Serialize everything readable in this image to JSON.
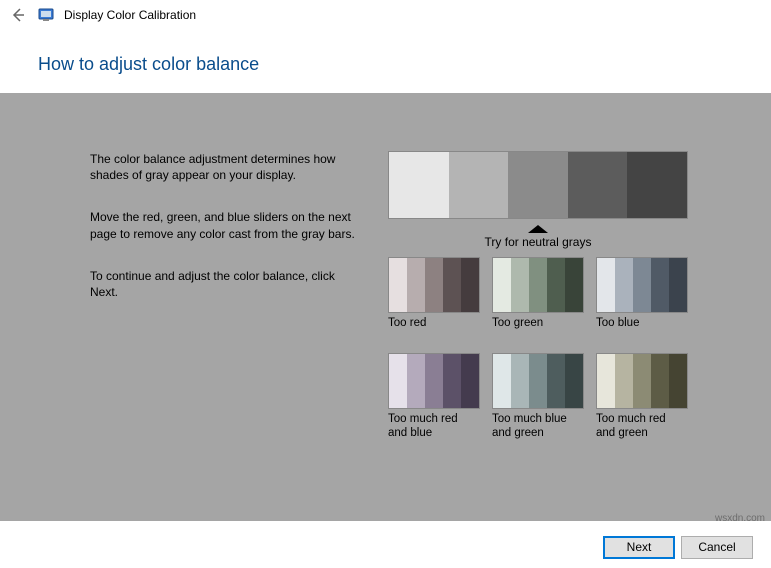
{
  "window": {
    "title": "Display Color Calibration"
  },
  "heading": "How to adjust color balance",
  "paragraphs": {
    "p1": "The color balance adjustment determines how shades of gray appear on your display.",
    "p2": "Move the red, green, and blue sliders on the next page to remove any color cast from the gray bars.",
    "p3": "To continue and adjust the color balance, click Next."
  },
  "neutral_label": "Try for neutral grays",
  "neutral_colors": [
    "#e7e7e7",
    "#b4b4b4",
    "#8b8b8b",
    "#5c5c5c",
    "#444444"
  ],
  "samples": [
    {
      "label": "Too red",
      "colors": [
        "#e6dfe0",
        "#b7adae",
        "#8d8181",
        "#5d5253",
        "#453c3e"
      ]
    },
    {
      "label": "Too green",
      "colors": [
        "#e4eae2",
        "#aeb9ad",
        "#809080",
        "#4f5e4f",
        "#394439"
      ]
    },
    {
      "label": "Too blue",
      "colors": [
        "#e3e6ea",
        "#aab2bc",
        "#7d8894",
        "#505a66",
        "#3b434d"
      ]
    },
    {
      "label": "Too much red and blue",
      "colors": [
        "#e6e1ea",
        "#b4aabc",
        "#8a7e94",
        "#5c5168",
        "#443b4e"
      ]
    },
    {
      "label": "Too much blue and green",
      "colors": [
        "#dfe7e8",
        "#a9b6b7",
        "#7b8c8d",
        "#4e5d5e",
        "#384545"
      ]
    },
    {
      "label": "Too much red and green",
      "colors": [
        "#e7e6db",
        "#b6b4a1",
        "#8c8b74",
        "#5d5c46",
        "#454432"
      ]
    }
  ],
  "buttons": {
    "next": "Next",
    "cancel": "Cancel"
  },
  "watermark": "wsxdn.com"
}
